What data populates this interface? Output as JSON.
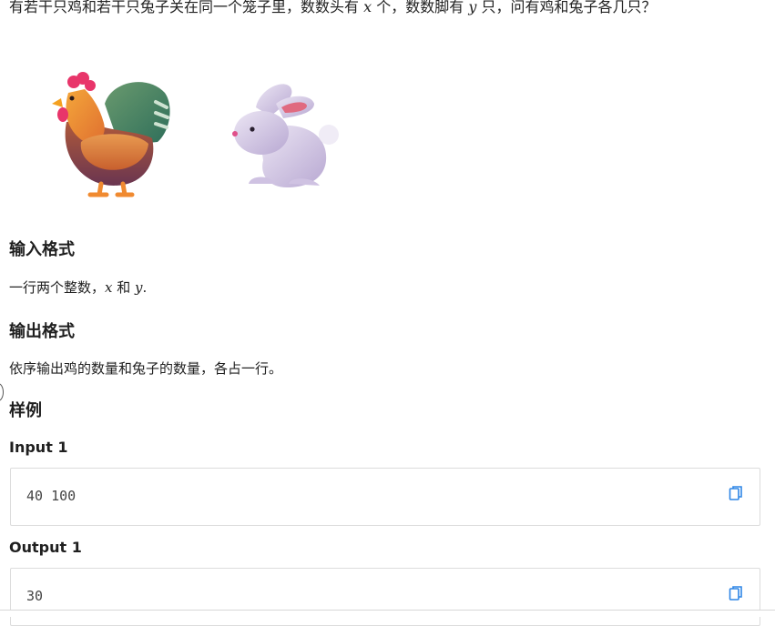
{
  "problem": {
    "text_before_x": "有若干只鸡和若干只兔子关在同一个笼子里，数数头有 ",
    "var_x": "x",
    "text_between": " 个，数数脚有 ",
    "var_y": "y",
    "text_after_y": " 只，问有鸡和兔子各几只？"
  },
  "illustration": {
    "items": [
      "rooster-icon",
      "rabbit-icon"
    ]
  },
  "input_format": {
    "heading": "输入格式",
    "text_before": "一行两个整数，",
    "var_x": "x",
    "text_middle": " 和 ",
    "var_y": "y",
    "text_after": "."
  },
  "output_format": {
    "heading": "输出格式",
    "text": "依序输出鸡的数量和兔子的数量，各占一行。"
  },
  "samples": {
    "heading": "样例",
    "input_label": "Input 1",
    "input_value": "40 100",
    "output_label": "Output 1",
    "output_value": "30"
  },
  "colors": {
    "copy_icon": "#2f86e6",
    "code_border": "#dcdcdc"
  }
}
